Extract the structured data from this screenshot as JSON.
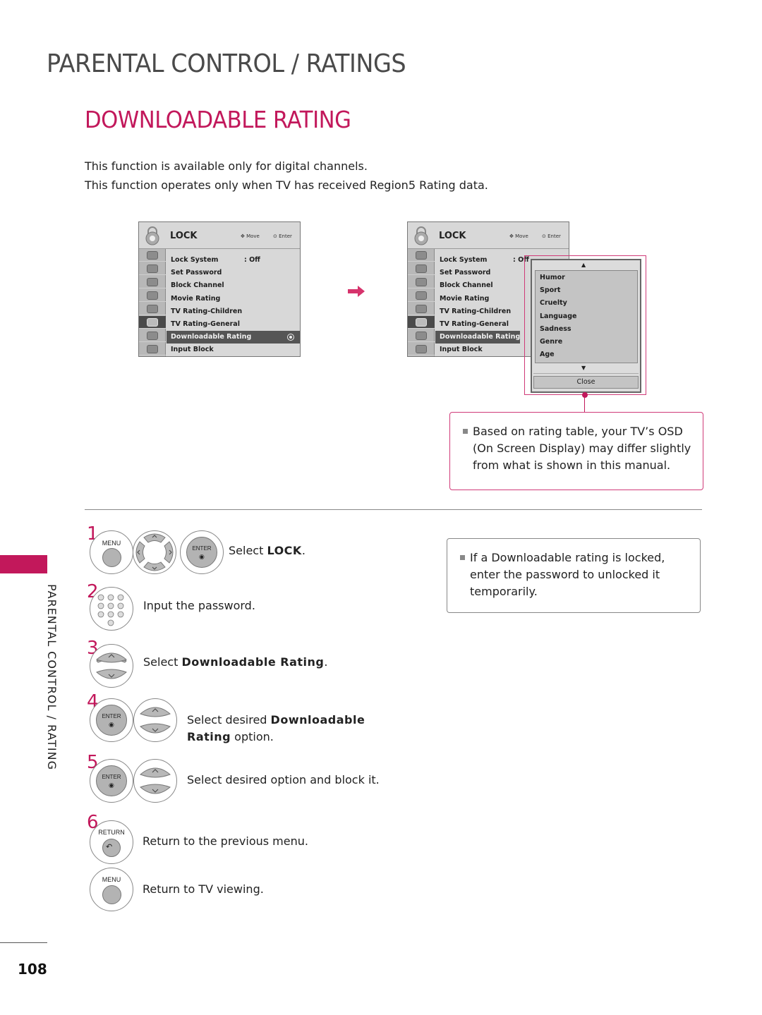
{
  "header": {
    "section_title": "PARENTAL CONTROL / RATINGS",
    "page_title": "DOWNLOADABLE RATING"
  },
  "intro": [
    "This function is available only for digital channels.",
    "This function operates only when TV has received Region5 Rating data."
  ],
  "osd_menu": {
    "title": "LOCK",
    "hint_move": "Move",
    "hint_enter": "Enter",
    "items": [
      {
        "label": "Lock System",
        "value": ": Off"
      },
      {
        "label": "Set Password"
      },
      {
        "label": "Block Channel"
      },
      {
        "label": "Movie Rating"
      },
      {
        "label": "TV Rating-Children"
      },
      {
        "label": "TV Rating-General"
      },
      {
        "label": "Downloadable Rating"
      },
      {
        "label": "Input Block"
      }
    ],
    "selected_item": "Downloadable Rating",
    "sidebar_icons": [
      "setup-icon",
      "picture-icon",
      "audio-icon",
      "time-icon",
      "option-icon",
      "lock-icon",
      "input-icon",
      "usb-icon"
    ]
  },
  "popup": {
    "items": [
      "Humor",
      "Sport",
      "Cruelty",
      "Language",
      "Sadness",
      "Genre",
      "Age"
    ],
    "close_label": "Close",
    "up_arrow": "▲",
    "down_arrow": "▼"
  },
  "notes": [
    "Based on rating table, your TV’s OSD (On Screen Display) may differ slightly from what is shown in this manual.",
    "If a Downloadable rating is locked, enter the password to unlocked it temporarily."
  ],
  "side_label": "PARENTAL CONTROL / RATING",
  "steps": [
    {
      "num": "1",
      "pre": "Select ",
      "bold": "LOCK",
      "post": "."
    },
    {
      "num": "2",
      "pre": "Input the password.",
      "bold": "",
      "post": ""
    },
    {
      "num": "3",
      "pre": "Select ",
      "bold": "Downloadable Rating",
      "post": "."
    },
    {
      "num": "4",
      "pre": "Select desired ",
      "bold": "Downloadable",
      "line2_bold": "Rating",
      "line2_post": " option."
    },
    {
      "num": "5",
      "pre": "Select desired option and block it.",
      "bold": "",
      "post": ""
    },
    {
      "num": "6",
      "pre": "Return to the previous menu.",
      "bold": "",
      "post": ""
    },
    {
      "num": "",
      "pre": "Return to TV viewing.",
      "bold": "",
      "post": ""
    }
  ],
  "buttons": {
    "menu": "MENU",
    "enter": "ENTER",
    "return": "RETURN"
  },
  "page_number": "108",
  "colors": {
    "accent": "#c2185b",
    "osd_bg": "#d8d8d8",
    "osd_selected": "#555555"
  }
}
